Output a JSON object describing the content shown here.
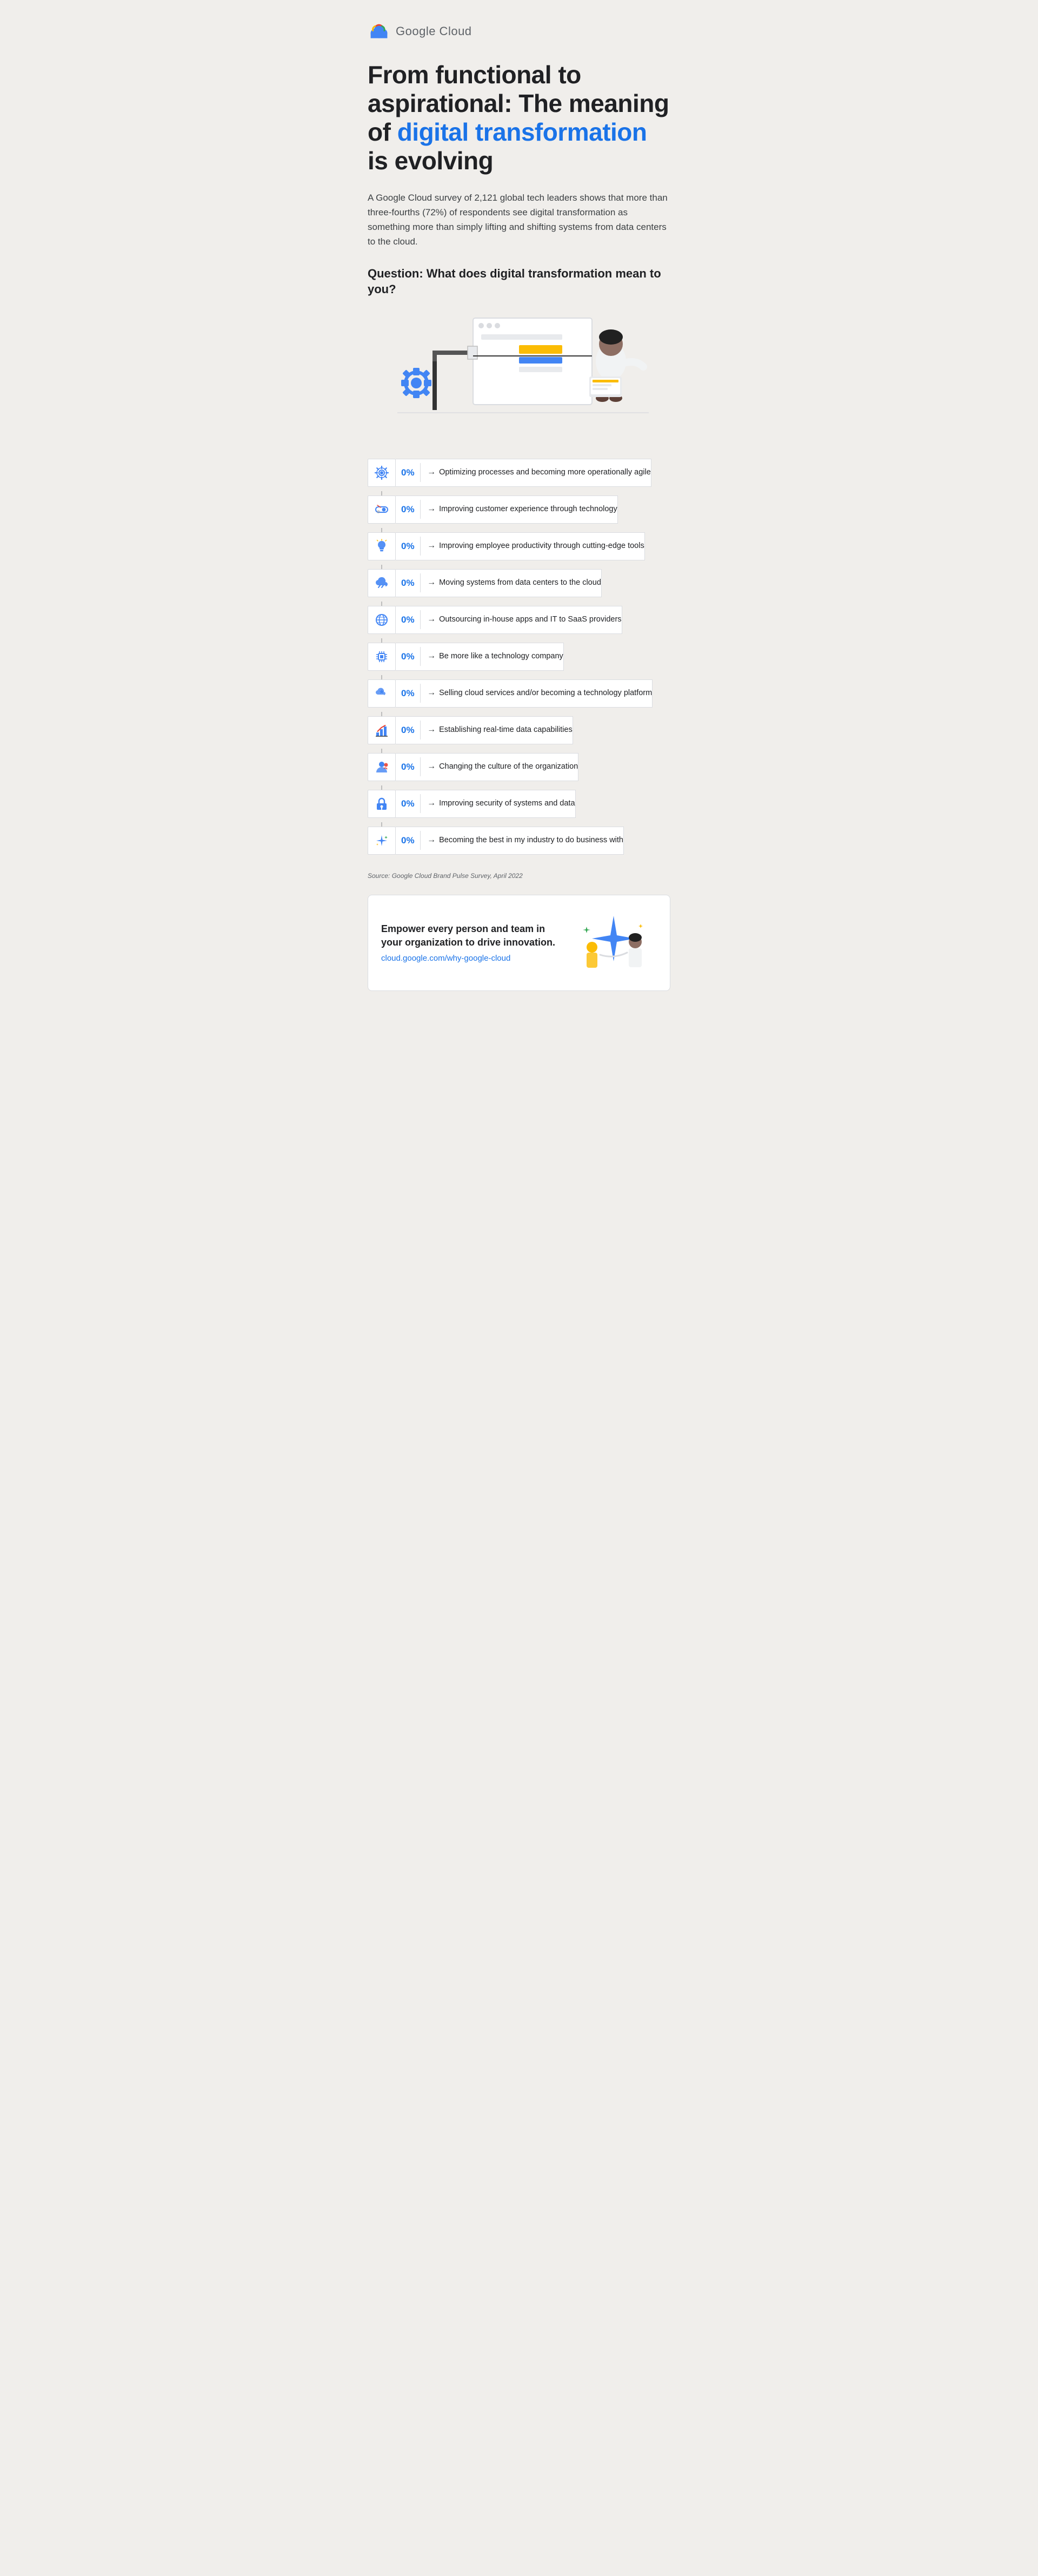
{
  "header": {
    "logo_text": "Google Cloud"
  },
  "main_title_part1": "From functional to aspirational: The meaning of ",
  "main_title_highlight": "digital transformation",
  "main_title_part2": " is evolving",
  "description": "A Google Cloud survey of 2,121 global tech leaders shows that more than three-fourths (72%) of respondents see digital transformation as something more than simply lifting and shifting systems from data centers to the cloud.",
  "question": "Question: What does digital transformation mean to you?",
  "chart_items": [
    {
      "pct": "0%",
      "label": "Optimizing processes and becoming more operationally agile",
      "icon": "gear"
    },
    {
      "pct": "0%",
      "label": "Improving customer experience through technology",
      "icon": "toggle"
    },
    {
      "pct": "0%",
      "label": "Improving employee productivity through cutting-edge tools",
      "icon": "lightbulb"
    },
    {
      "pct": "0%",
      "label": "Moving systems from data centers to the cloud",
      "icon": "cloud"
    },
    {
      "pct": "0%",
      "label": "Outsourcing in-house apps and IT to SaaS providers",
      "icon": "globe"
    },
    {
      "pct": "0%",
      "label": "Be more like a technology company",
      "icon": "chip"
    },
    {
      "pct": "0%",
      "label": "Selling cloud services and/or becoming a technology platform",
      "icon": "star-cloud"
    },
    {
      "pct": "0%",
      "label": "Establishing real-time data capabilities",
      "icon": "chart"
    },
    {
      "pct": "0%",
      "label": "Changing the culture of the organization",
      "icon": "person"
    },
    {
      "pct": "0%",
      "label": "Improving security of systems and data",
      "icon": "lock"
    },
    {
      "pct": "0%",
      "label": "Becoming the best in my industry to do business with",
      "icon": "sparkle"
    }
  ],
  "source": "Source: Google Cloud Brand Pulse Survey, April 2022",
  "cta": {
    "title": "Empower every person and team in your organization to drive innovation.",
    "link": "cloud.google.com/why-google-cloud"
  }
}
